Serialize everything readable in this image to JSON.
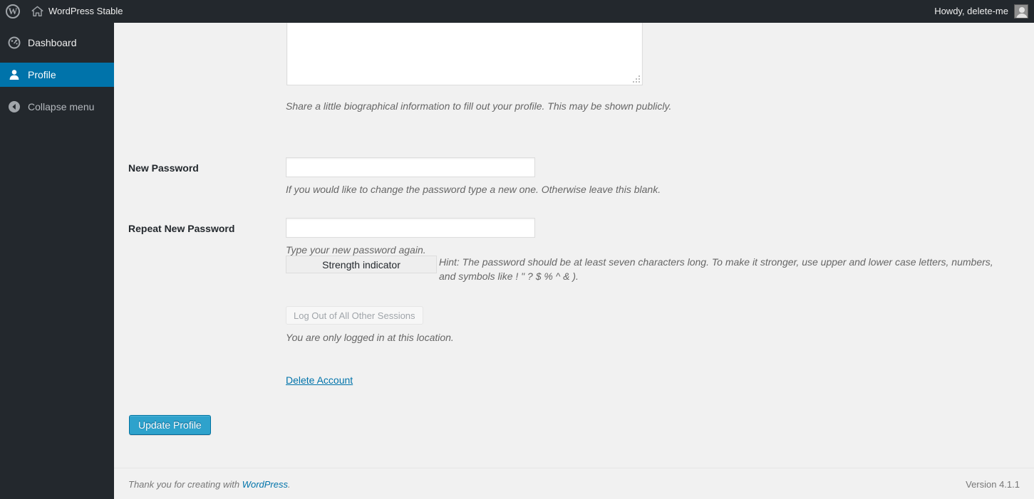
{
  "adminbar": {
    "wp_logo_label": "W",
    "site_name": "WordPress Stable",
    "howdy": "Howdy, delete-me",
    "icons": {
      "wp": "wordpress-logo-icon",
      "home": "home-icon",
      "avatar": "avatar"
    }
  },
  "sidebar": {
    "items": [
      {
        "id": "dashboard",
        "label": "Dashboard",
        "icon": "dashboard-gauge-icon",
        "active": false
      },
      {
        "id": "profile",
        "label": "Profile",
        "icon": "user-icon",
        "active": true
      },
      {
        "id": "collapse",
        "label": "Collapse menu",
        "icon": "collapse-arrow-icon",
        "active": false
      }
    ]
  },
  "form": {
    "biography": {
      "value": "",
      "description": "Share a little biographical information to fill out your profile. This may be shown publicly."
    },
    "new_password": {
      "label": "New Password",
      "value": "",
      "description": "If you would like to change the password type a new one. Otherwise leave this blank."
    },
    "repeat_password": {
      "label": "Repeat New Password",
      "value": "",
      "description": "Type your new password again."
    },
    "strength_indicator": {
      "label": "Strength indicator",
      "hint": "Hint: The password should be at least seven characters long. To make it stronger, use upper and lower case letters, numbers, and symbols like ! \" ? $ % ^ & )."
    },
    "sessions": {
      "button_label": "Log Out of All Other Sessions",
      "description": "You are only logged in at this location."
    },
    "delete_account_link": "Delete Account",
    "submit_label": "Update Profile"
  },
  "footer": {
    "thanks_prefix": "Thank you for creating with ",
    "wordpress_link": "WordPress",
    "thanks_suffix": ".",
    "version": "Version 4.1.1"
  },
  "colors": {
    "admin_bar_bg": "#23282d",
    "sidebar_bg": "#23282d",
    "accent": "#0073aa",
    "primary_button": "#2ea2cc",
    "content_bg": "#f1f1f1"
  }
}
